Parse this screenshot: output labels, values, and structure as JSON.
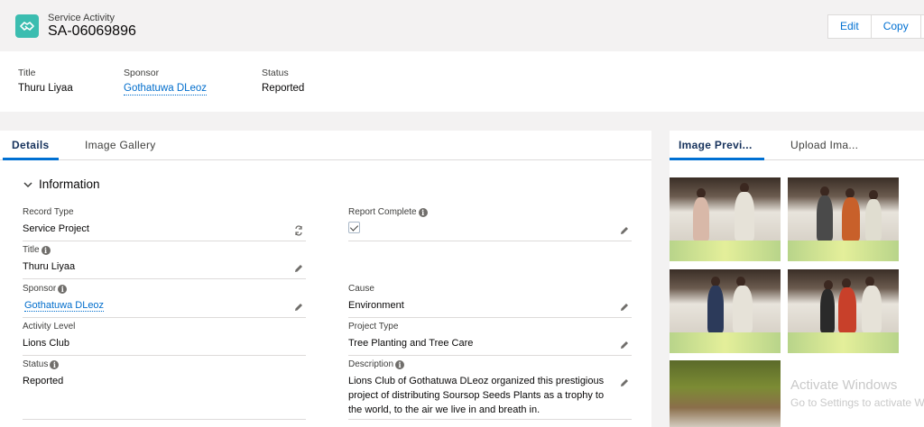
{
  "header": {
    "object_label": "Service Activity",
    "record_name": "SA-06069896",
    "buttons": [
      "Edit",
      "Copy"
    ]
  },
  "highlights": [
    {
      "label": "Title",
      "value": "Thuru Liyaa",
      "link": false
    },
    {
      "label": "Sponsor",
      "value": "Gothatuwa DLeoz",
      "link": true
    },
    {
      "label": "Status",
      "value": "Reported",
      "link": false
    }
  ],
  "main_tabs": [
    "Details",
    "Image Gallery"
  ],
  "section": {
    "title": "Information"
  },
  "fields": {
    "record_type": {
      "label": "Record Type",
      "value": "Service Project"
    },
    "report_complete": {
      "label": "Report Complete",
      "checked": true
    },
    "title": {
      "label": "Title",
      "value": "Thuru Liyaa"
    },
    "sponsor": {
      "label": "Sponsor",
      "value": "Gothatuwa DLeoz"
    },
    "cause": {
      "label": "Cause",
      "value": "Environment"
    },
    "activity_level": {
      "label": "Activity Level",
      "value": "Lions Club"
    },
    "project_type": {
      "label": "Project Type",
      "value": "Tree Planting and Tree Care"
    },
    "status": {
      "label": "Status",
      "value": "Reported"
    },
    "description": {
      "label": "Description",
      "value": "Lions Club of Gothatuwa DLeoz organized this prestigious project of distributing Soursop Seeds Plants as a trophy to the world, to the air we live in and breath in."
    }
  },
  "side_tabs": [
    "Image Previ...",
    "Upload Ima..."
  ],
  "watermark": {
    "line1": "Activate Windows",
    "line2": "Go to Settings to activate W"
  },
  "colors": {
    "brand": "#3bbdb0",
    "link": "#006dcc",
    "accent": "#0070d2"
  }
}
